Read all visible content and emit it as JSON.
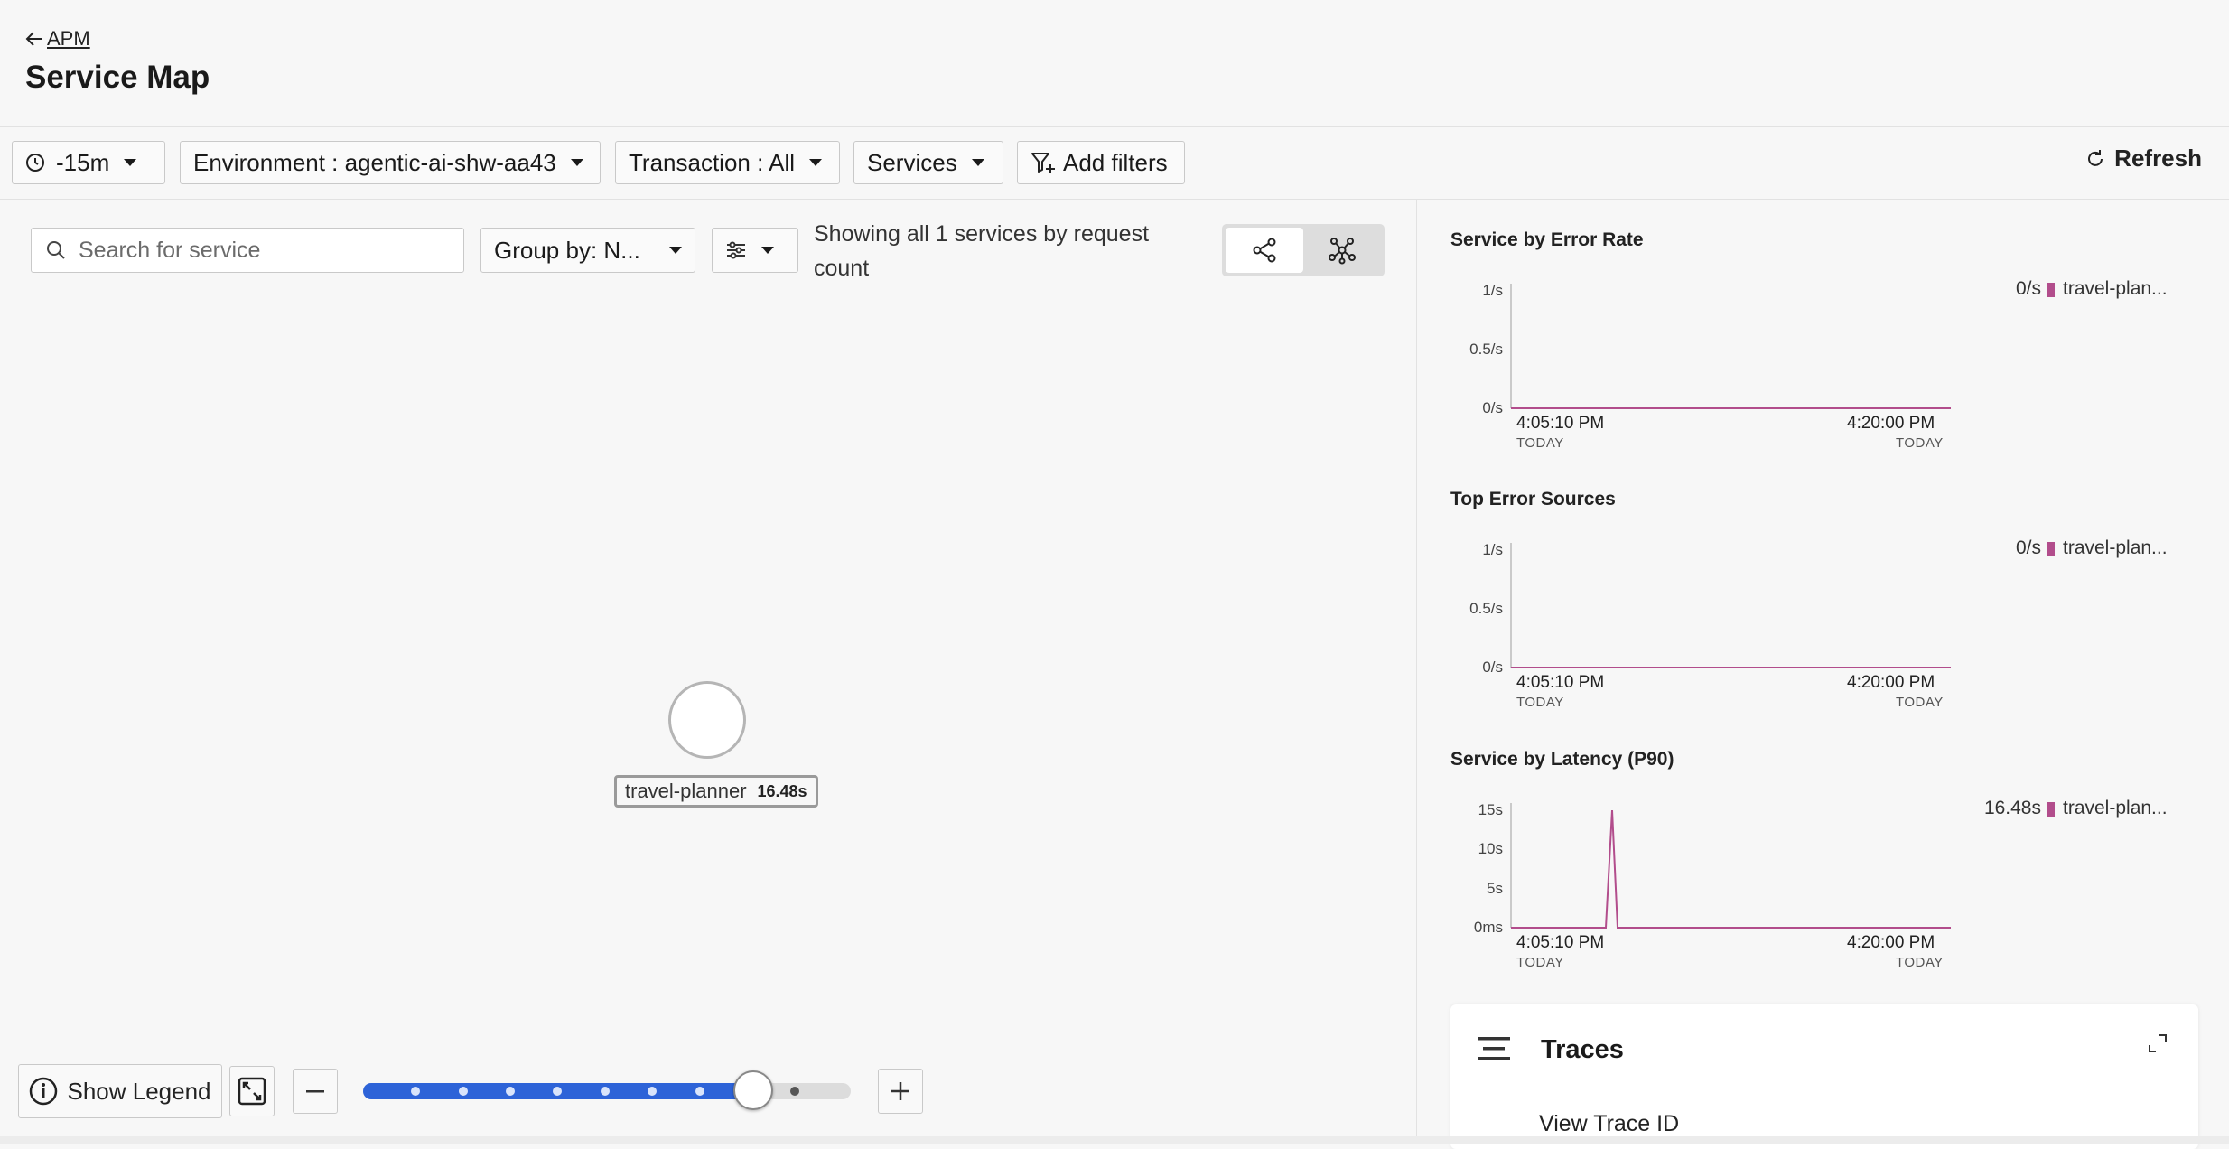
{
  "header": {
    "back_label": "APM",
    "title": "Service Map"
  },
  "toolbar": {
    "time_range": "-15m",
    "environment": "Environment : agentic-ai-shw-aa43",
    "transaction": "Transaction : All",
    "services": "Services",
    "add_filters": "Add filters",
    "refresh": "Refresh"
  },
  "map_controls": {
    "search_placeholder": "Search for service",
    "group_by": "Group by: N...",
    "showing_text": "Showing all 1 services by request count"
  },
  "map": {
    "node_name": "travel-planner",
    "node_latency": "16.48s"
  },
  "bottom_controls": {
    "legend_label": "Show Legend",
    "zoom_level": 0.8
  },
  "charts": [
    {
      "title": "Service by Error Rate",
      "yticks": [
        "1/s",
        "0.5/s",
        "0/s"
      ],
      "x_start": "4:05:10 PM",
      "x_end": "4:20:00 PM",
      "day_label": "TODAY",
      "legend_value": "0/s",
      "legend_name": "travel-plan..."
    },
    {
      "title": "Top Error Sources",
      "yticks": [
        "1/s",
        "0.5/s",
        "0/s"
      ],
      "x_start": "4:05:10 PM",
      "x_end": "4:20:00 PM",
      "day_label": "TODAY",
      "legend_value": "0/s",
      "legend_name": "travel-plan..."
    },
    {
      "title": "Service by Latency (P90)",
      "yticks": [
        "15s",
        "10s",
        "5s",
        "0ms"
      ],
      "x_start": "4:05:10 PM",
      "x_end": "4:20:00 PM",
      "day_label": "TODAY",
      "legend_value": "16.48s",
      "legend_name": "travel-plan..."
    }
  ],
  "chart_data": [
    {
      "type": "line",
      "title": "Service by Error Rate",
      "ylim": [
        0,
        1
      ],
      "series": [
        {
          "name": "travel-plan...",
          "values": [
            0,
            0
          ]
        }
      ]
    },
    {
      "type": "line",
      "title": "Top Error Sources",
      "ylim": [
        0,
        1
      ],
      "series": [
        {
          "name": "travel-plan...",
          "values": [
            0,
            0
          ]
        }
      ]
    },
    {
      "type": "line",
      "title": "Service by Latency (P90)",
      "ylim": [
        0,
        16.48
      ],
      "series": [
        {
          "name": "travel-plan...",
          "values": [
            0,
            0,
            16.48,
            0,
            0
          ]
        }
      ]
    }
  ],
  "traces": {
    "title": "Traces",
    "view_trace_id": "View Trace ID"
  },
  "colors": {
    "series": "#b24d8c",
    "slider": "#2d63d8"
  }
}
